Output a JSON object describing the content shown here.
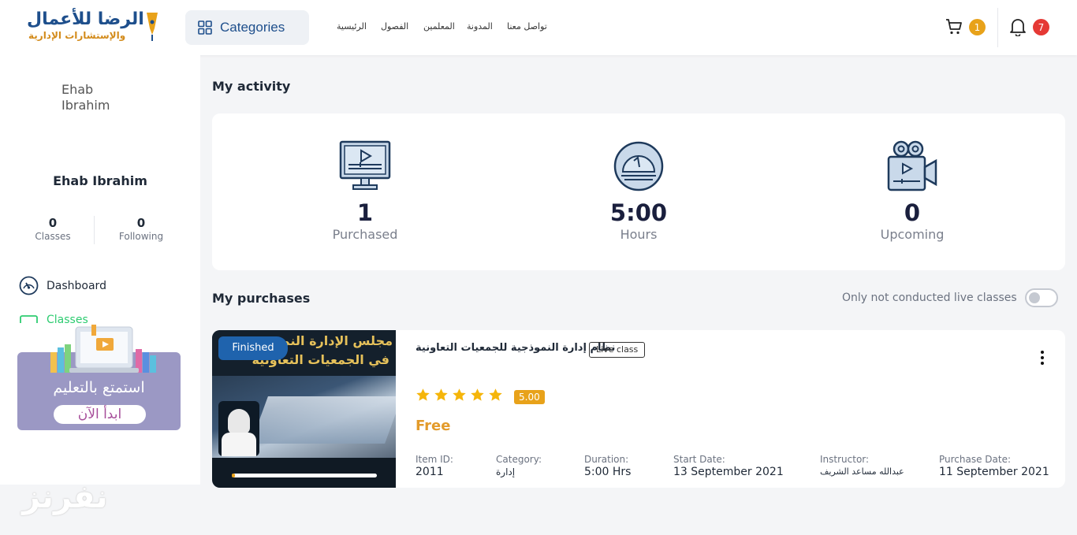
{
  "header": {
    "logo_line1": "الرضا للأعمال",
    "logo_line2": "والإستشارات الإدارية",
    "categories_label": "Categories",
    "nav": [
      "تواصل معنا",
      "المدونة",
      "المعلمين",
      "الفصول",
      "الرئيسية"
    ],
    "cart_count": "1",
    "notifications_count": "7"
  },
  "sidebar": {
    "avatar_alt": "Ehab Ibrahim",
    "user_name": "Ehab Ibrahim",
    "stats": [
      {
        "value": "0",
        "label": "Classes"
      },
      {
        "value": "0",
        "label": "Following"
      }
    ],
    "menu": [
      {
        "label": "Dashboard",
        "icon": "dashboard-gauge-icon"
      },
      {
        "label": "Classes",
        "icon": "classes-icon"
      }
    ],
    "promo": {
      "text": "استمتع بالتعليم",
      "button": "ابدأ الآن"
    }
  },
  "watermark": "نفرنز",
  "activity": {
    "title": "My activity",
    "items": [
      {
        "value": "1",
        "label": "Purchased",
        "icon": "monitor-play-icon"
      },
      {
        "value": "5:00",
        "label": "Hours",
        "icon": "clock-dome-icon"
      },
      {
        "value": "0",
        "label": "Upcoming",
        "icon": "video-camera-icon"
      }
    ]
  },
  "purchases": {
    "title": "My purchases",
    "filter_label": "Only not conducted live classes",
    "filter_on": false,
    "items": [
      {
        "status": "Finished",
        "title": "نظام إدارة النموذجية للجمعيات التعاونية",
        "type": "Live class",
        "rating": "5.00",
        "stars": 5,
        "price": "Free",
        "progress": 0.02,
        "thumb_line1": "مجلس الإدارة النموذجي",
        "thumb_line2": "في الجمعيات التعاونية",
        "meta": [
          {
            "key": "Item ID:",
            "value": "2011"
          },
          {
            "key": "Category:",
            "value": "إدارة"
          },
          {
            "key": "Duration:",
            "value": "5:00 Hrs"
          },
          {
            "key": "Start Date:",
            "value": "13 September 2021"
          },
          {
            "key": "Instructor:",
            "value": "عبدالله مساعد الشريف"
          },
          {
            "key": "Purchase Date:",
            "value": "11 September 2021"
          }
        ]
      }
    ]
  },
  "colors": {
    "brand_blue": "#1e4f8c",
    "accent_orange": "#e8a21a",
    "badge_red": "#e53935",
    "price_orange": "#e39b2b",
    "promo_purple": "#9b98c4",
    "finished_blue": "#1f63ad"
  }
}
